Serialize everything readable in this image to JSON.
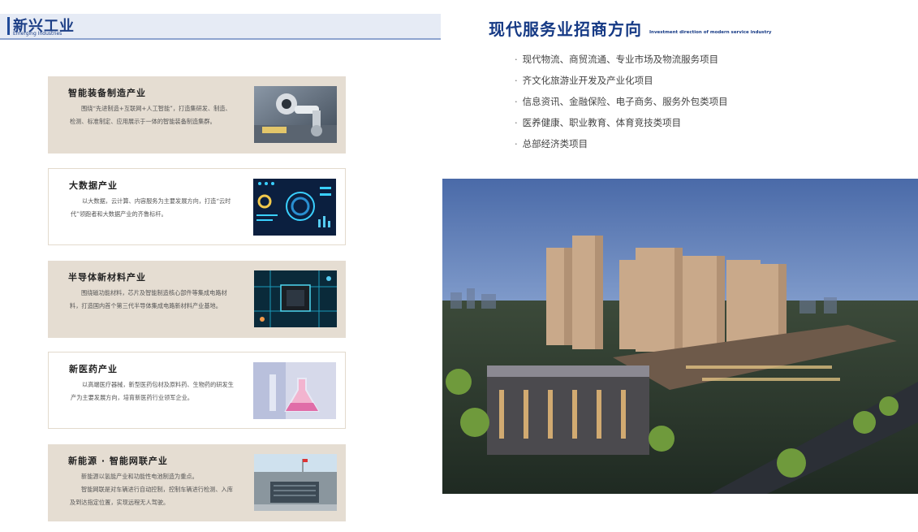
{
  "left_header": {
    "title": "新兴工业",
    "subtitle": "Emerging Industries"
  },
  "industries": [
    {
      "title": "智能装备制造产业",
      "desc": [
        "围绕“先进制造+互联网+人工智能”，打造集研发、制造、检测、标准制定、应用展示于一体的智能装备制造集群。"
      ],
      "image": "robot-arm"
    },
    {
      "title": "大数据产业",
      "desc": [
        "以大数据，云计算、内容服务为主要发展方向，打造“云时代”领跑者和大数据产业的齐鲁标杆。"
      ],
      "image": "data-dashboard"
    },
    {
      "title": "半导体新材料产业",
      "desc": [
        "围绕磁功能材料，芯片及智能制造核心部件等集成电路材料，打造国内首个第三代半导体集成电路新材料产业基地。"
      ],
      "image": "circuit-chip"
    },
    {
      "title": "新医药产业",
      "desc": [
        "以高端医疗器械，新型医药包材及原料药、生物药的研发生产为主要发展方向，培育新医药行业领军企业。"
      ],
      "image": "lab-flask"
    },
    {
      "title": "新能源 · 智能网联产业",
      "desc": [
        "新能源以氢能产业和功能性电池制造为重点。",
        "智能网联是对车辆进行自动控制，控制车辆进行检测、入库及到达指定位置，实现远程无人驾驶。"
      ],
      "image": "industrial-building"
    }
  ],
  "right": {
    "title": "现代服务业招商方向",
    "subtitle": "Investment direction of modern service industry",
    "items": [
      "现代物流、商贸流通、专业市场及物流服务项目",
      "齐文化旅游业开发及产业化项目",
      "信息资讯、金融保险、电子商务、服务外包类项目",
      "医养健康、职业教育、体育竞技类项目",
      "总部经济类项目"
    ],
    "bullet": "·"
  }
}
